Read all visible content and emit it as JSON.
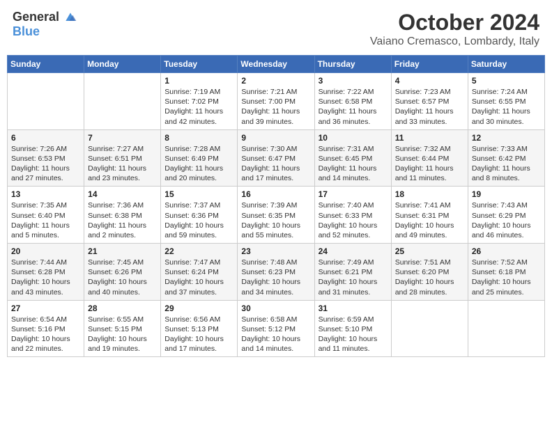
{
  "header": {
    "logo_general": "General",
    "logo_blue": "Blue",
    "month_title": "October 2024",
    "location": "Vaiano Cremasco, Lombardy, Italy"
  },
  "weekdays": [
    "Sunday",
    "Monday",
    "Tuesday",
    "Wednesday",
    "Thursday",
    "Friday",
    "Saturday"
  ],
  "weeks": [
    [
      {
        "day": "",
        "sunrise": "",
        "sunset": "",
        "daylight": ""
      },
      {
        "day": "",
        "sunrise": "",
        "sunset": "",
        "daylight": ""
      },
      {
        "day": "1",
        "sunrise": "Sunrise: 7:19 AM",
        "sunset": "Sunset: 7:02 PM",
        "daylight": "Daylight: 11 hours and 42 minutes."
      },
      {
        "day": "2",
        "sunrise": "Sunrise: 7:21 AM",
        "sunset": "Sunset: 7:00 PM",
        "daylight": "Daylight: 11 hours and 39 minutes."
      },
      {
        "day": "3",
        "sunrise": "Sunrise: 7:22 AM",
        "sunset": "Sunset: 6:58 PM",
        "daylight": "Daylight: 11 hours and 36 minutes."
      },
      {
        "day": "4",
        "sunrise": "Sunrise: 7:23 AM",
        "sunset": "Sunset: 6:57 PM",
        "daylight": "Daylight: 11 hours and 33 minutes."
      },
      {
        "day": "5",
        "sunrise": "Sunrise: 7:24 AM",
        "sunset": "Sunset: 6:55 PM",
        "daylight": "Daylight: 11 hours and 30 minutes."
      }
    ],
    [
      {
        "day": "6",
        "sunrise": "Sunrise: 7:26 AM",
        "sunset": "Sunset: 6:53 PM",
        "daylight": "Daylight: 11 hours and 27 minutes."
      },
      {
        "day": "7",
        "sunrise": "Sunrise: 7:27 AM",
        "sunset": "Sunset: 6:51 PM",
        "daylight": "Daylight: 11 hours and 23 minutes."
      },
      {
        "day": "8",
        "sunrise": "Sunrise: 7:28 AM",
        "sunset": "Sunset: 6:49 PM",
        "daylight": "Daylight: 11 hours and 20 minutes."
      },
      {
        "day": "9",
        "sunrise": "Sunrise: 7:30 AM",
        "sunset": "Sunset: 6:47 PM",
        "daylight": "Daylight: 11 hours and 17 minutes."
      },
      {
        "day": "10",
        "sunrise": "Sunrise: 7:31 AM",
        "sunset": "Sunset: 6:45 PM",
        "daylight": "Daylight: 11 hours and 14 minutes."
      },
      {
        "day": "11",
        "sunrise": "Sunrise: 7:32 AM",
        "sunset": "Sunset: 6:44 PM",
        "daylight": "Daylight: 11 hours and 11 minutes."
      },
      {
        "day": "12",
        "sunrise": "Sunrise: 7:33 AM",
        "sunset": "Sunset: 6:42 PM",
        "daylight": "Daylight: 11 hours and 8 minutes."
      }
    ],
    [
      {
        "day": "13",
        "sunrise": "Sunrise: 7:35 AM",
        "sunset": "Sunset: 6:40 PM",
        "daylight": "Daylight: 11 hours and 5 minutes."
      },
      {
        "day": "14",
        "sunrise": "Sunrise: 7:36 AM",
        "sunset": "Sunset: 6:38 PM",
        "daylight": "Daylight: 11 hours and 2 minutes."
      },
      {
        "day": "15",
        "sunrise": "Sunrise: 7:37 AM",
        "sunset": "Sunset: 6:36 PM",
        "daylight": "Daylight: 10 hours and 59 minutes."
      },
      {
        "day": "16",
        "sunrise": "Sunrise: 7:39 AM",
        "sunset": "Sunset: 6:35 PM",
        "daylight": "Daylight: 10 hours and 55 minutes."
      },
      {
        "day": "17",
        "sunrise": "Sunrise: 7:40 AM",
        "sunset": "Sunset: 6:33 PM",
        "daylight": "Daylight: 10 hours and 52 minutes."
      },
      {
        "day": "18",
        "sunrise": "Sunrise: 7:41 AM",
        "sunset": "Sunset: 6:31 PM",
        "daylight": "Daylight: 10 hours and 49 minutes."
      },
      {
        "day": "19",
        "sunrise": "Sunrise: 7:43 AM",
        "sunset": "Sunset: 6:29 PM",
        "daylight": "Daylight: 10 hours and 46 minutes."
      }
    ],
    [
      {
        "day": "20",
        "sunrise": "Sunrise: 7:44 AM",
        "sunset": "Sunset: 6:28 PM",
        "daylight": "Daylight: 10 hours and 43 minutes."
      },
      {
        "day": "21",
        "sunrise": "Sunrise: 7:45 AM",
        "sunset": "Sunset: 6:26 PM",
        "daylight": "Daylight: 10 hours and 40 minutes."
      },
      {
        "day": "22",
        "sunrise": "Sunrise: 7:47 AM",
        "sunset": "Sunset: 6:24 PM",
        "daylight": "Daylight: 10 hours and 37 minutes."
      },
      {
        "day": "23",
        "sunrise": "Sunrise: 7:48 AM",
        "sunset": "Sunset: 6:23 PM",
        "daylight": "Daylight: 10 hours and 34 minutes."
      },
      {
        "day": "24",
        "sunrise": "Sunrise: 7:49 AM",
        "sunset": "Sunset: 6:21 PM",
        "daylight": "Daylight: 10 hours and 31 minutes."
      },
      {
        "day": "25",
        "sunrise": "Sunrise: 7:51 AM",
        "sunset": "Sunset: 6:20 PM",
        "daylight": "Daylight: 10 hours and 28 minutes."
      },
      {
        "day": "26",
        "sunrise": "Sunrise: 7:52 AM",
        "sunset": "Sunset: 6:18 PM",
        "daylight": "Daylight: 10 hours and 25 minutes."
      }
    ],
    [
      {
        "day": "27",
        "sunrise": "Sunrise: 6:54 AM",
        "sunset": "Sunset: 5:16 PM",
        "daylight": "Daylight: 10 hours and 22 minutes."
      },
      {
        "day": "28",
        "sunrise": "Sunrise: 6:55 AM",
        "sunset": "Sunset: 5:15 PM",
        "daylight": "Daylight: 10 hours and 19 minutes."
      },
      {
        "day": "29",
        "sunrise": "Sunrise: 6:56 AM",
        "sunset": "Sunset: 5:13 PM",
        "daylight": "Daylight: 10 hours and 17 minutes."
      },
      {
        "day": "30",
        "sunrise": "Sunrise: 6:58 AM",
        "sunset": "Sunset: 5:12 PM",
        "daylight": "Daylight: 10 hours and 14 minutes."
      },
      {
        "day": "31",
        "sunrise": "Sunrise: 6:59 AM",
        "sunset": "Sunset: 5:10 PM",
        "daylight": "Daylight: 10 hours and 11 minutes."
      },
      {
        "day": "",
        "sunrise": "",
        "sunset": "",
        "daylight": ""
      },
      {
        "day": "",
        "sunrise": "",
        "sunset": "",
        "daylight": ""
      }
    ]
  ]
}
